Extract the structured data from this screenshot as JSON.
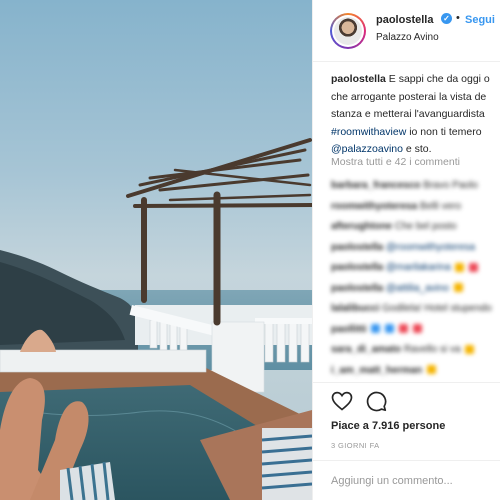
{
  "post": {
    "username": "paolostella",
    "follow_label": "Segui",
    "location": "Palazzo Avino"
  },
  "caption": {
    "username": "paolostella",
    "text_1": "E sappi che da oggi o",
    "text_2": "che arrogante posterai la vista de",
    "text_3": "stanza e metterai l'avanguardista",
    "hashtag": "#roomwithaview",
    "text_4": " io non ti temero",
    "mention": "@palazzoavino",
    "text_5": " e sto."
  },
  "comments_link": "Mostra tutti e 42 i commenti",
  "comments": [
    {
      "user": "barbara_francesco",
      "text": "Bravo Paolo"
    },
    {
      "user": "roomwithyoteresa",
      "text": "Belli vero"
    },
    {
      "user": "afterughtone",
      "text": "Che bel posto"
    },
    {
      "user": "paolostella",
      "mention": "@roomwithyoteresa"
    },
    {
      "user": "paolostella",
      "mention": "@marilakarina"
    },
    {
      "user": "paolostella",
      "mention": "@attilia_avino"
    },
    {
      "user": "lalalibucci",
      "text": "Godilela! Hotel stupendo"
    },
    {
      "user": "paollitti",
      "text": ""
    },
    {
      "user": "sara_di_amato",
      "text": "Ravello si va"
    },
    {
      "user": "i_am_matt_herman",
      "text": ""
    }
  ],
  "likes_text": "Piace a 7.916 persone",
  "time_text": "3 GIORNI FA",
  "comment_placeholder": "Aggiungi un commento...",
  "colors": {
    "link": "#3897f0",
    "verified": "#3897f0",
    "emoji_blue": "#3897f0",
    "emoji_red": "#ed4956",
    "emoji_yellow": "#f5b400"
  },
  "icons": [
    "verified-badge-icon",
    "heart-icon",
    "comment-icon"
  ]
}
